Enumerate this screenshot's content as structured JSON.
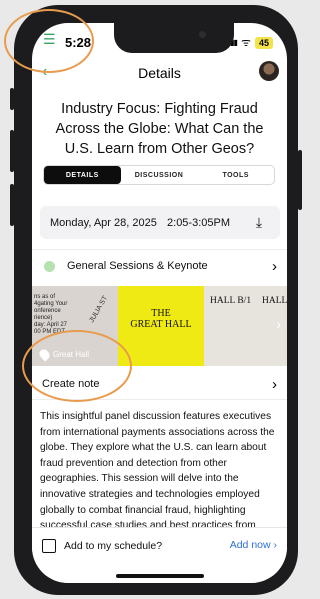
{
  "status": {
    "time": "5:28",
    "signal": "▮▮▮",
    "wifi": "ᯤ",
    "battery": "45"
  },
  "nav": {
    "title": "Details",
    "back_icon": "chevron-left-icon",
    "menu_icon": "hamburger-icon"
  },
  "session": {
    "title": "Industry Focus: Fighting Fraud Across the Globe: What Can the U.S. Learn from Other Geos?",
    "tabs": [
      {
        "label": "DETAILS"
      },
      {
        "label": "DISCUSSION"
      },
      {
        "label": "TOOLS"
      }
    ],
    "date": "Monday, Apr 28, 2025",
    "time_range": "2:05-3:05PM",
    "track": "General Sessions & Keynote",
    "create_note": "Create note",
    "description": "This insightful panel discussion features executives from international payments associations across the globe. They explore what the U.S. can learn about fraud prevention and detection from other geographies. This session will delve into the innovative strategies and technologies employed globally to combat financial fraud, highlighting successful case studies and best practices from regions that have made significant strides in this"
  },
  "map": {
    "location_label": "Great Hall",
    "panel_a_text": "ns as of\n4gating Your\nonference\nrience)\nday: April 27\n00 PM EDT",
    "street": "JULIA ST",
    "panel_b_line1": "THE",
    "panel_b_line2": "GREAT HALL",
    "panel_c_text1": "HALL B/1",
    "panel_c_text2": "HALL"
  },
  "bottom": {
    "schedule_prompt": "Add to my schedule?",
    "add_now": "Add now ›"
  },
  "colors": {
    "accent_green": "#3aa35c",
    "link_blue": "#2f6fd6",
    "highlight": "#e89b4d",
    "map_yellow": "#f0ea14"
  }
}
